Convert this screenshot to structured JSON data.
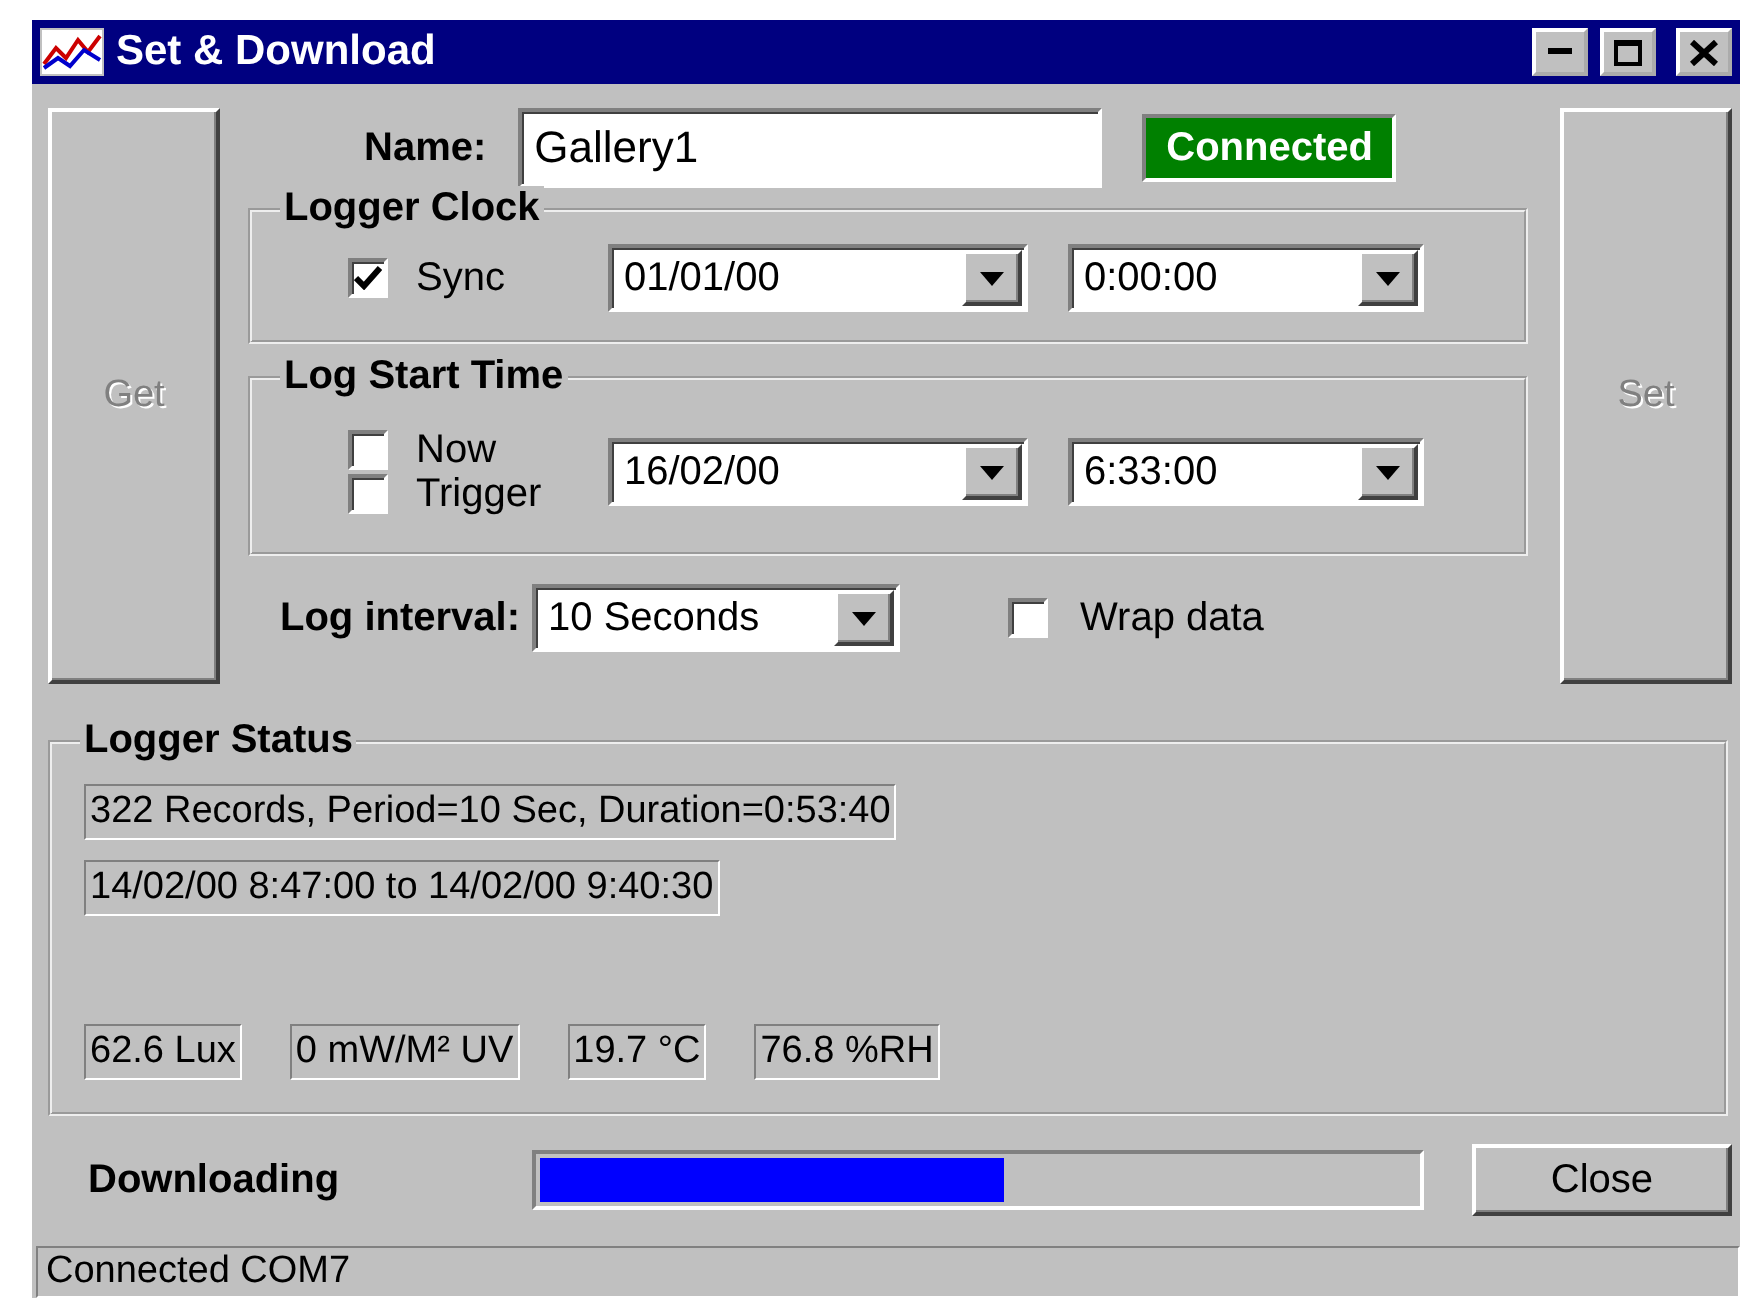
{
  "window": {
    "title": "Set & Download"
  },
  "left_button": {
    "label": "Get",
    "disabled": true
  },
  "right_button": {
    "label": "Set",
    "disabled": true
  },
  "name": {
    "label": "Name:",
    "value": "Gallery1"
  },
  "connection_badge": "Connected",
  "logger_clock": {
    "title": "Logger Clock",
    "checkboxes": [
      {
        "label": "Sync",
        "checked": true
      }
    ],
    "date": "01/01/00",
    "time": "0:00:00"
  },
  "log_start_time": {
    "title": "Log Start Time",
    "checkboxes": [
      {
        "label": "Now",
        "checked": false
      },
      {
        "label": "Trigger",
        "checked": false
      }
    ],
    "date": "16/02/00",
    "time": "6:33:00"
  },
  "log_interval": {
    "label": "Log interval:",
    "value": "10 Seconds"
  },
  "wrap_data": {
    "label": "Wrap data",
    "checked": false
  },
  "logger_status": {
    "title": "Logger Status",
    "summary": "322 Records, Period=10 Sec, Duration=0:53:40",
    "range": "14/02/00 8:47:00  to 14/02/00 9:40:30",
    "readings": [
      "62.6 Lux",
      "0 mW/M² UV",
      "19.7 °C",
      "76.8 %RH"
    ]
  },
  "download": {
    "label": "Downloading",
    "level": 0.53
  },
  "close_button": "Close",
  "status_bar": "Connected COM7"
}
